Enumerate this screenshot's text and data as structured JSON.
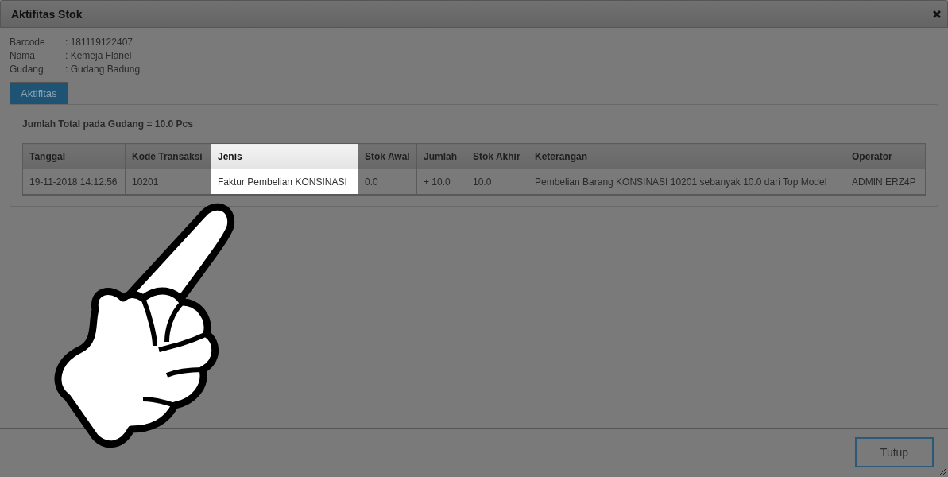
{
  "dialog": {
    "title": "Aktifitas Stok"
  },
  "info": [
    {
      "label": "Barcode",
      "value": ": 181119122407"
    },
    {
      "label": "Nama",
      "value": ": Kemeja Flanel"
    },
    {
      "label": "Gudang",
      "value": ": Gudang Badung"
    }
  ],
  "tabs": [
    {
      "label": "Aktifitas",
      "selected": true
    }
  ],
  "total": "Jumlah Total pada Gudang = 10.0 Pcs",
  "table": {
    "columns": [
      {
        "label": "Tanggal",
        "spotlight": false
      },
      {
        "label": "Kode Transaksi",
        "spotlight": false
      },
      {
        "label": "Jenis",
        "spotlight": true
      },
      {
        "label": "Stok Awal",
        "spotlight": false
      },
      {
        "label": "Jumlah",
        "spotlight": false
      },
      {
        "label": "Stok Akhir",
        "spotlight": false
      },
      {
        "label": "Keterangan",
        "spotlight": false
      },
      {
        "label": "Operator",
        "spotlight": false
      }
    ],
    "rows": [
      [
        "19-11-2018 14:12:56",
        "10201",
        "Faktur Pembelian KONSINASI",
        "0.0",
        "+ 10.0",
        "10.0",
        "Pembelian Barang KONSINASI 10201 sebanyak 10.0 dari Top Model",
        "ADMIN ERZ4P"
      ]
    ]
  },
  "buttons": [
    "Tutup"
  ]
}
